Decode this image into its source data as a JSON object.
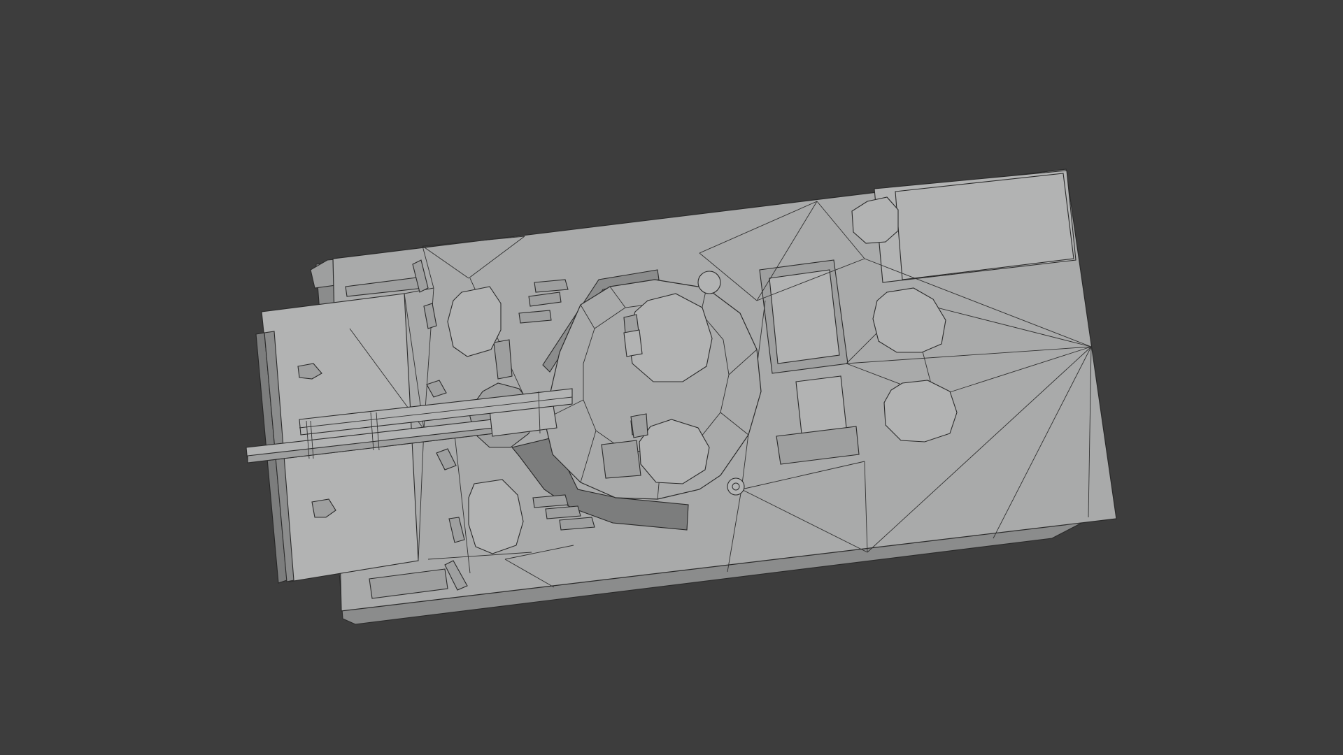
{
  "viewport": {
    "background_color": "#3d3d3d",
    "mesh_color": "#a9aaaa",
    "wire_color": "#2a2a2a"
  }
}
